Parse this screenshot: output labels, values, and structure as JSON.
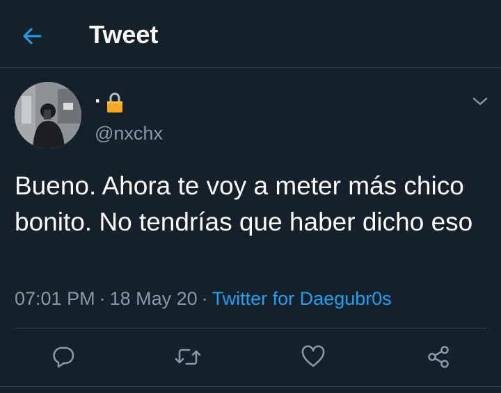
{
  "header": {
    "title": "Tweet",
    "back_icon": "back-arrow-icon"
  },
  "author": {
    "display_name_prefix": "·",
    "lock_icon": "lock-icon",
    "handle": "@nxchx"
  },
  "tweet": {
    "text": "Bueno. Ahora te voy a meter más chico bonito. No tendrías que haber dicho eso",
    "time": "07:01 PM",
    "date": "18 May 20",
    "separator": "·",
    "source": "Twitter for Daegubr0s"
  },
  "actions": {
    "reply_icon": "reply-icon",
    "retweet_icon": "retweet-icon",
    "like_icon": "heart-icon",
    "share_icon": "share-icon"
  },
  "colors": {
    "background": "#15202b",
    "accent": "#1da1f2",
    "muted": "#8899a6",
    "border": "#38444d"
  }
}
